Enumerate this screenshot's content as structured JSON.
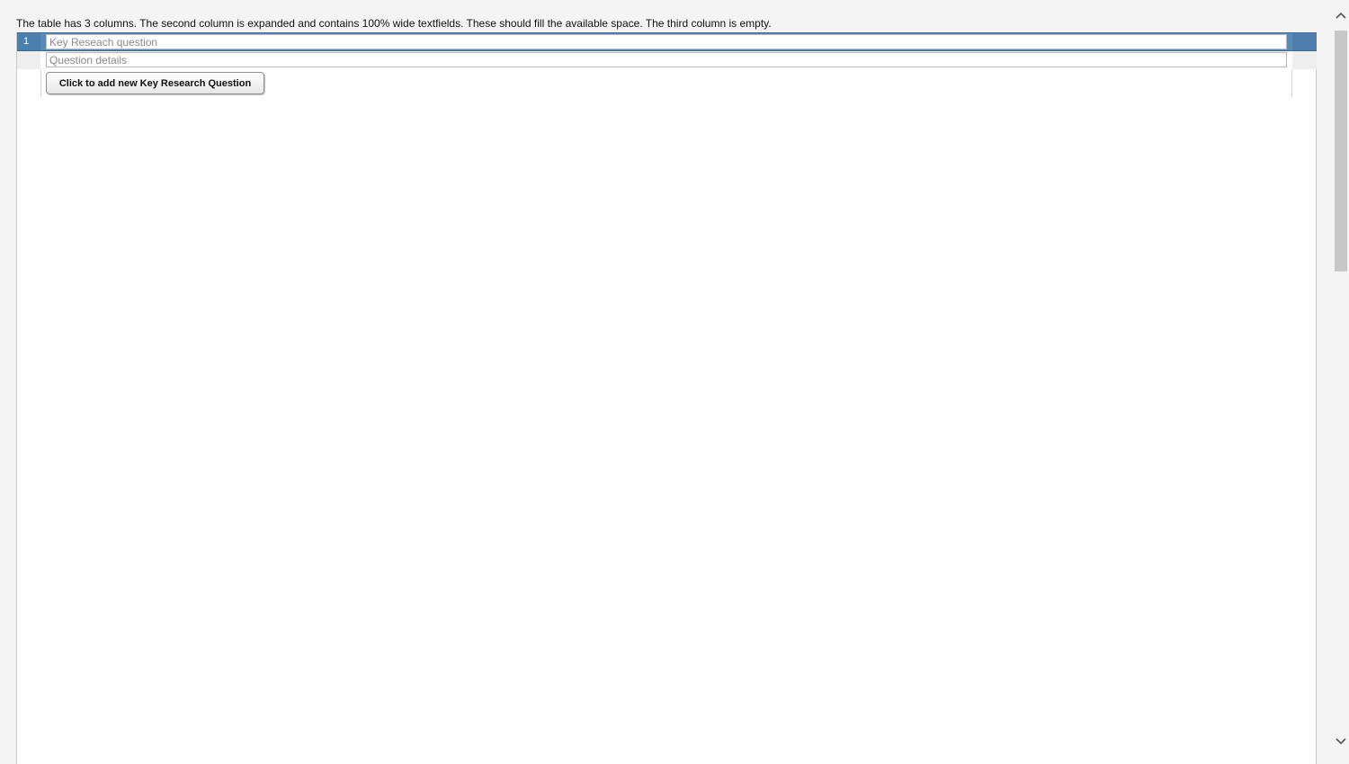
{
  "description": "The table has 3 columns. The second column is expanded and contains 100% wide textfields. These should fill the available space. The third column is empty.",
  "table": {
    "rows": [
      {
        "number": "1",
        "question_placeholder": "Key Reseach question",
        "details_placeholder": "Question details"
      }
    ],
    "add_button_label": "Click to add new Key Research Question"
  },
  "scrollbar": {
    "up_icon": "chevron-up-icon",
    "down_icon": "chevron-down-icon"
  },
  "colors": {
    "header_row": "#4c7fae",
    "background": "#f4f4f4"
  }
}
